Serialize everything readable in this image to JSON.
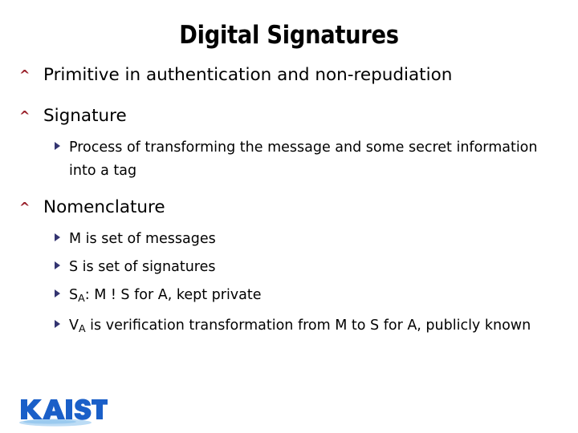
{
  "slide": {
    "title": "Digital Signatures",
    "background_color": "#ffffff",
    "title_color": "#000000",
    "level1_marker_glyph": "^",
    "level1_marker_color": "#99202a",
    "level2_marker_glyph": "▶",
    "level2_marker_color": "#333470",
    "body_text_color": "#000000"
  },
  "bullets": {
    "b1_text": "Primitive in authentication and non-repudiation",
    "b2_text": "Signature",
    "b2_sub1": "Process of transforming the message and some secret information into a tag",
    "b3_text": "Nomenclature",
    "b3_sub1": "M is set of messages",
    "b3_sub2": "S is set of signatures",
    "b3_sub3_pre": "S",
    "b3_sub3_sub": "A",
    "b3_sub3_post": ": M ! S for A, kept private",
    "b3_sub4_pre": "V",
    "b3_sub4_sub": "A",
    "b3_sub4_post": " is verification transformation from M to S for A, publicly known"
  },
  "logo": {
    "name": "KAIST",
    "text": "KAIST",
    "text_color": "#1a5fc8",
    "swoosh_color": "#bcdcf5"
  }
}
